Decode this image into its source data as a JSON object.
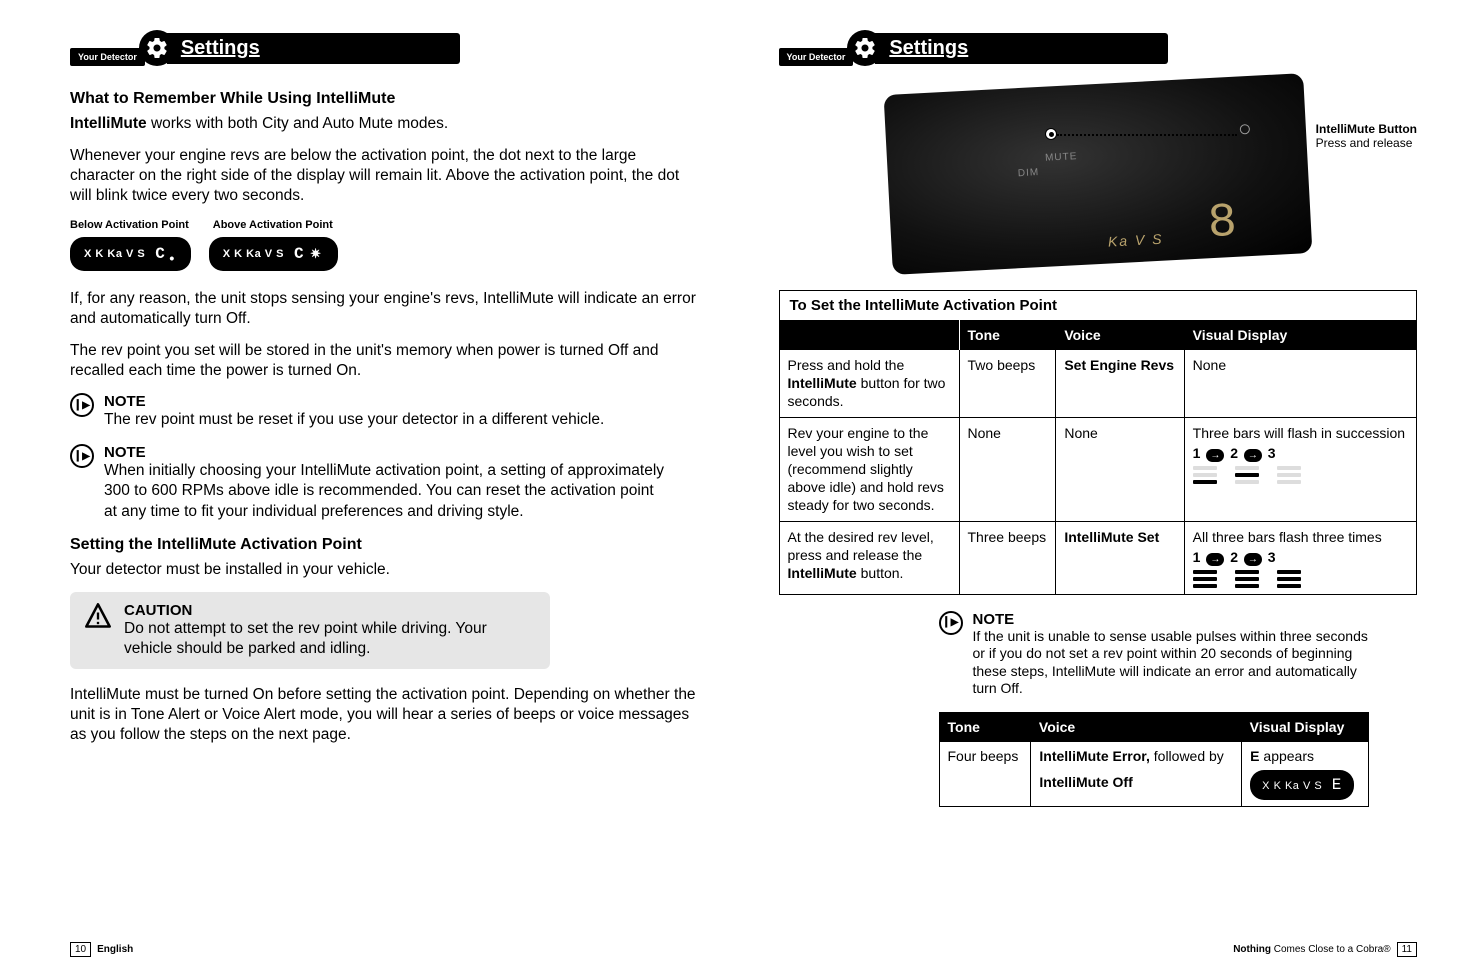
{
  "header": {
    "your_detector": "Your Detector",
    "settings": "Settings"
  },
  "left": {
    "what_title": "What to Remember While Using IntelliMute",
    "intellimute_intro_bold": "IntelliMute",
    "intellimute_intro_rest": " works with both City and Auto Mute modes.",
    "para2": "Whenever your engine revs are below the activation point, the dot next to the large character on the right side of the display will remain lit. Above the activation point, the dot will blink twice every two seconds.",
    "below_ap": "Below Activation Point",
    "above_ap": "Above Activation Point",
    "pill_text": "X K Ka V S",
    "pill_char": "C",
    "para3": "If, for any reason, the unit stops sensing your engine's revs, IntelliMute will indicate an error and automatically turn Off.",
    "para4": "The rev point you set will be stored in the unit's memory when power is turned Off and recalled each time the power is turned On.",
    "note1_title": "NOTE",
    "note1_body": "The rev point must be reset if you use your detector in a different vehicle.",
    "note2_title": "NOTE",
    "note2_body": "When initially choosing your IntelliMute activation point, a setting of approximately 300 to 600 RPMs above idle is recommended. You can reset the activation point at any time to fit your individual preferences and driving style.",
    "setting_title": "Setting the IntelliMute Activation Point",
    "setting_body": "Your detector must be installed in your vehicle.",
    "caution_title": "CAUTION",
    "caution_body": "Do not attempt to set the rev point while driving. Your vehicle should be parked and idling.",
    "para5": "IntelliMute must be turned On before setting the activation point. Depending on whether the unit is in Tone Alert or Voice Alert mode, you will hear a series of beeps or voice messages as you follow the steps on the next page."
  },
  "right": {
    "callout_bold": "IntelliMute Button",
    "callout_sub": "Press and release",
    "device_dim": "DIM",
    "device_mute": "MUTE",
    "device_vs": "Ka V S",
    "device_seg": "8",
    "set_header": "To Set the IntelliMute Activation Point",
    "th_tone": "Tone",
    "th_voice": "Voice",
    "th_visual": "Visual Display",
    "rows": [
      {
        "step": "Press and hold the IntelliMute button for two seconds.",
        "step_bold": "IntelliMute",
        "tone": "Two beeps",
        "voice": "Set Engine Revs",
        "visual": "None"
      },
      {
        "step": "Rev your engine to the level you wish to set (recommend slightly above idle) and hold revs steady for two seconds.",
        "tone": "None",
        "voice": "None",
        "visual_line1": "Three bars will flash in succession",
        "labels": "1 ⟶ 2 ⟶ 3"
      },
      {
        "step": "At the desired rev level, press and release the IntelliMute button.",
        "step_bold": "IntelliMute",
        "tone": "Three beeps",
        "voice": "IntelliMute Set",
        "visual_line1": "All three bars flash three times",
        "labels": "1 ⟶ 2 ⟶ 3"
      }
    ],
    "note_title": "NOTE",
    "note_body": "If the unit is unable to sense usable pulses within three seconds or if you do not set a rev point within 20 seconds of beginning these steps, IntelliMute will indicate an error and automatically turn Off.",
    "err_th_tone": "Tone",
    "err_th_voice": "Voice",
    "err_th_visual": "Visual Display",
    "err_tone": "Four beeps",
    "err_voice_bold1": "IntelliMute Error,",
    "err_voice_rest1": " followed by",
    "err_voice_bold2": "IntelliMute Off",
    "err_visual_bold": "E",
    "err_visual_rest": " appears",
    "err_pill_text": "X K Ka V S",
    "err_pill_char": "E"
  },
  "footer": {
    "left_num": "10",
    "left_text": "English",
    "right_bold": "Nothing",
    "right_rest": " Comes Close to a Cobra®",
    "right_num": "11"
  }
}
